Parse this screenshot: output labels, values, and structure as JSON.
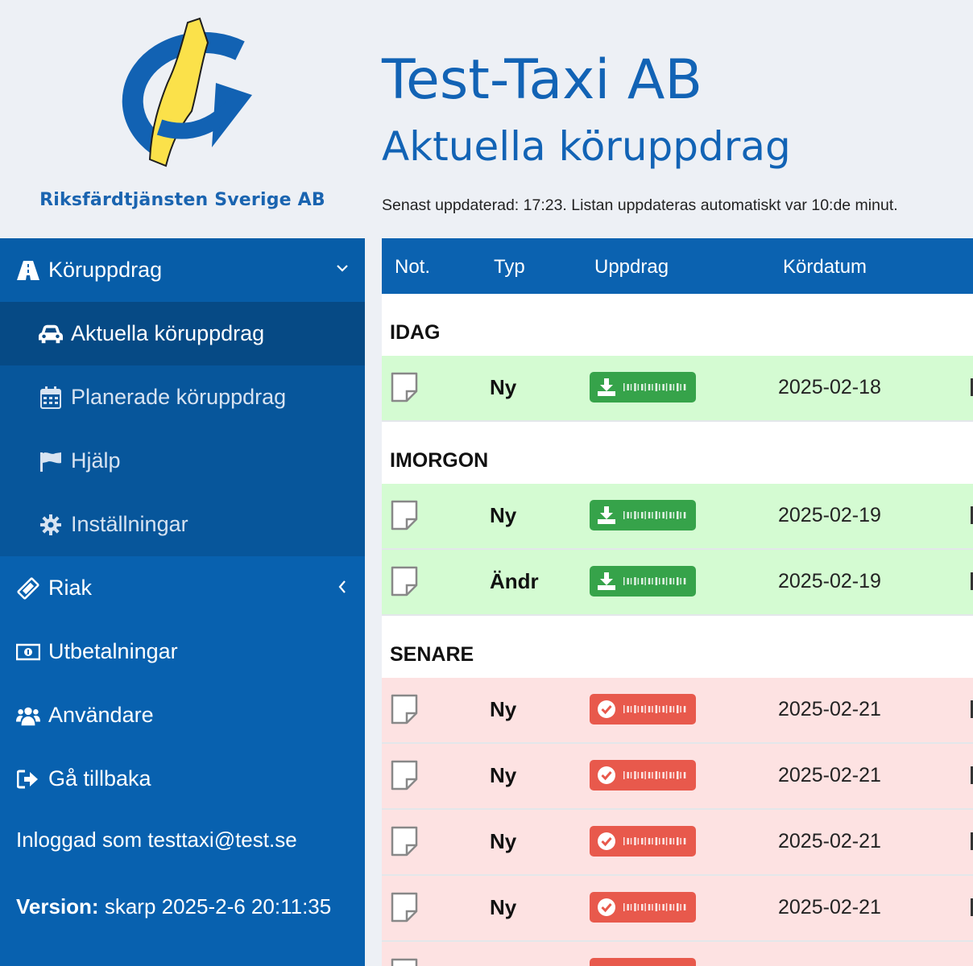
{
  "header": {
    "company": "Riksfärdtjänsten Sverige AB",
    "app_title": "Test-Taxi AB",
    "page_title": "Aktuella köruppdrag",
    "updated_text": "Senast uppdaterad: 17:23. Listan uppdateras automatiskt var 10:de minut."
  },
  "sidebar": {
    "group": {
      "label": "Köruppdrag",
      "icon": "road-icon"
    },
    "sub_items": [
      {
        "label": "Aktuella köruppdrag",
        "icon": "car-icon",
        "active": true
      },
      {
        "label": "Planerade köruppdrag",
        "icon": "calendar-icon"
      },
      {
        "label": "Hjälp",
        "icon": "flag-icon"
      },
      {
        "label": "Inställningar",
        "icon": "gear-icon"
      }
    ],
    "items": [
      {
        "label": "Riak",
        "icon": "ticket-icon"
      },
      {
        "label": "Utbetalningar",
        "icon": "money-icon"
      },
      {
        "label": "Användare",
        "icon": "users-icon"
      },
      {
        "label": "Gå tillbaka",
        "icon": "sign-out-icon"
      }
    ],
    "logged_in": "Inloggad som testtaxi@test.se",
    "version_label": "Version:",
    "version_value": "skarp 2025-2-6 20:11:35"
  },
  "table": {
    "columns": [
      "Not.",
      "Typ",
      "Uppdrag",
      "Kördatum"
    ],
    "sections": [
      {
        "title": "IDAG",
        "rows": [
          {
            "typ": "Ny",
            "status": "download",
            "date": "2025-02-18"
          }
        ]
      },
      {
        "title": "IMORGON",
        "rows": [
          {
            "typ": "Ny",
            "status": "download",
            "date": "2025-02-19"
          },
          {
            "typ": "Ändr",
            "status": "download",
            "date": "2025-02-19"
          }
        ]
      },
      {
        "title": "SENARE",
        "rows": [
          {
            "typ": "Ny",
            "status": "done",
            "date": "2025-02-21"
          },
          {
            "typ": "Ny",
            "status": "done",
            "date": "2025-02-21"
          },
          {
            "typ": "Ny",
            "status": "done",
            "date": "2025-02-21"
          },
          {
            "typ": "Ny",
            "status": "done",
            "date": "2025-02-21"
          }
        ]
      }
    ]
  },
  "colors": {
    "brand_blue": "#0861af",
    "header_blue": "#1263b5",
    "green_row": "#d4fbd2",
    "red_row": "#fde2e2",
    "green_btn": "#36a34a",
    "red_btn": "#e8594c"
  }
}
